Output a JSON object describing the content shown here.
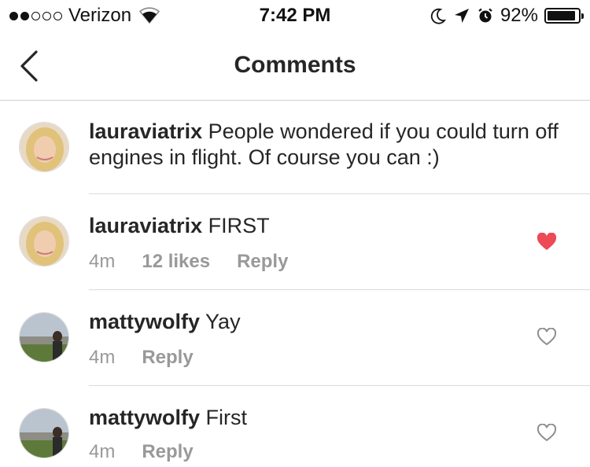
{
  "status_bar": {
    "carrier": "Verizon",
    "time": "7:42 PM",
    "battery_percent": "92%",
    "battery_level": 0.92
  },
  "nav": {
    "title": "Comments"
  },
  "caption": {
    "username": "lauraviatrix",
    "text": "People wondered if you could turn off engines in flight. Of course you can :)"
  },
  "comments": [
    {
      "username": "lauraviatrix",
      "text": "FIRST",
      "time": "4m",
      "likes": "12 likes",
      "reply": "Reply",
      "liked": true
    },
    {
      "username": "mattywolfy",
      "text": "Yay",
      "time": "4m",
      "reply": "Reply",
      "liked": false
    },
    {
      "username": "mattywolfy",
      "text": "First",
      "time": "4m",
      "reply": "Reply",
      "liked": false
    }
  ],
  "colors": {
    "heart_liked": "#ed4956",
    "heart_outline": "#8e8e8e"
  }
}
